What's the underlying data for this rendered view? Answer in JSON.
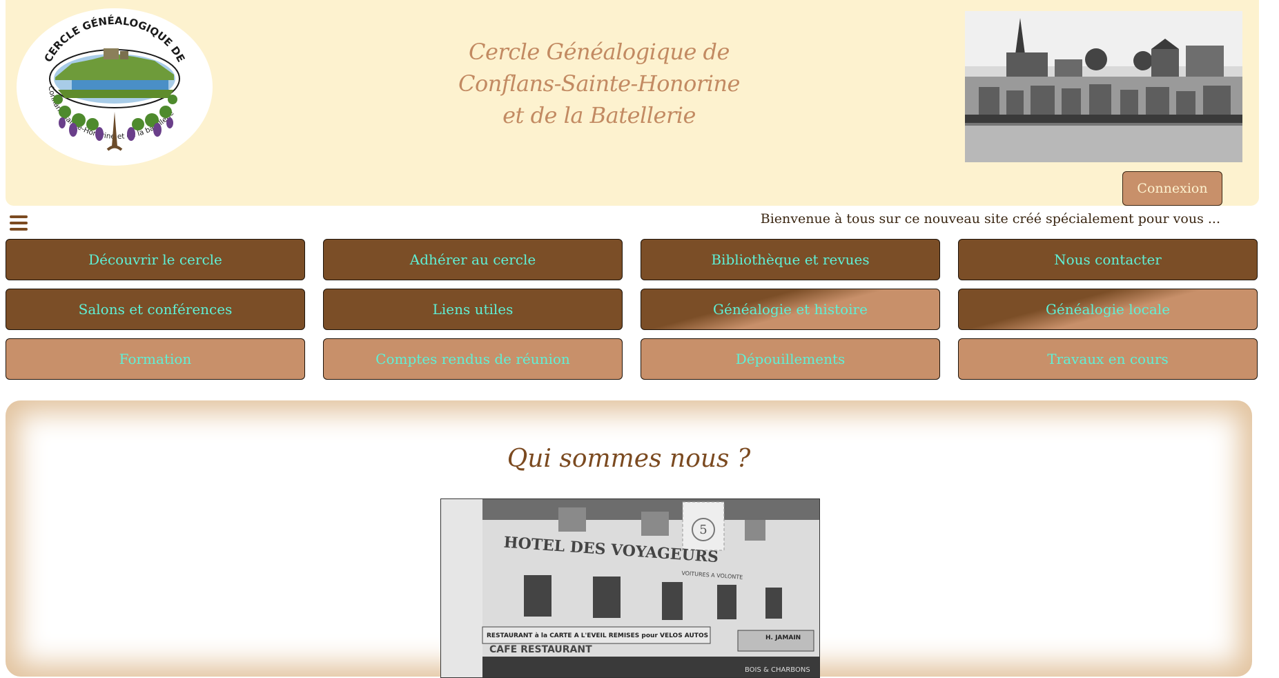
{
  "header": {
    "logo": {
      "text_top": "CERCLE GÉNÉALOGIQUE DE",
      "text_bottom": "Conflans-Sainte-Honorine et de la batellerie"
    },
    "title_lines": [
      "Cercle Généalogique de",
      "Conflans-Sainte-Honorine",
      "et de la Batellerie"
    ],
    "login_label": "Connexion"
  },
  "welcome_text": "Bienvenue à tous sur ce nouveau site créé spécialement pour vous ...",
  "nav": {
    "items": [
      {
        "label": "Découvrir le cercle",
        "style": "dark"
      },
      {
        "label": "Adhérer au cercle",
        "style": "dark"
      },
      {
        "label": "Bibliothèque et revues",
        "style": "dark"
      },
      {
        "label": "Nous contacter",
        "style": "dark"
      },
      {
        "label": "Salons et conférences",
        "style": "dark"
      },
      {
        "label": "Liens utiles",
        "style": "dark"
      },
      {
        "label": "Généalogie et histoire",
        "style": "grad"
      },
      {
        "label": "Généalogie locale",
        "style": "grad"
      },
      {
        "label": "Formation",
        "style": "light"
      },
      {
        "label": "Comptes rendus de réunion",
        "style": "light"
      },
      {
        "label": "Dépouillements",
        "style": "light"
      },
      {
        "label": "Travaux en cours",
        "style": "light"
      }
    ]
  },
  "main": {
    "title": "Qui sommes nous ?",
    "photo": {
      "hotel_sign": "HOTEL DES VOYAGEURS",
      "sign_small": "VOITURES A VOLONTE",
      "restaurant_sign": "RESTAURANT à la CARTE A L'EVEIL REMISES pour VELOS AUTOS",
      "cafe_sign": "CAFE RESTAURANT",
      "right_sign": "H. JAMAIN",
      "bottom_sign": "BOIS & CHARBONS",
      "stamp": "5"
    }
  },
  "colors": {
    "header_bg": "#fdf2cf",
    "title_color": "#c28a62",
    "nav_dark": "#7b4e27",
    "nav_light": "#c8906a",
    "nav_text": "#5ff0d6",
    "heading_brown": "#7b4a20"
  }
}
